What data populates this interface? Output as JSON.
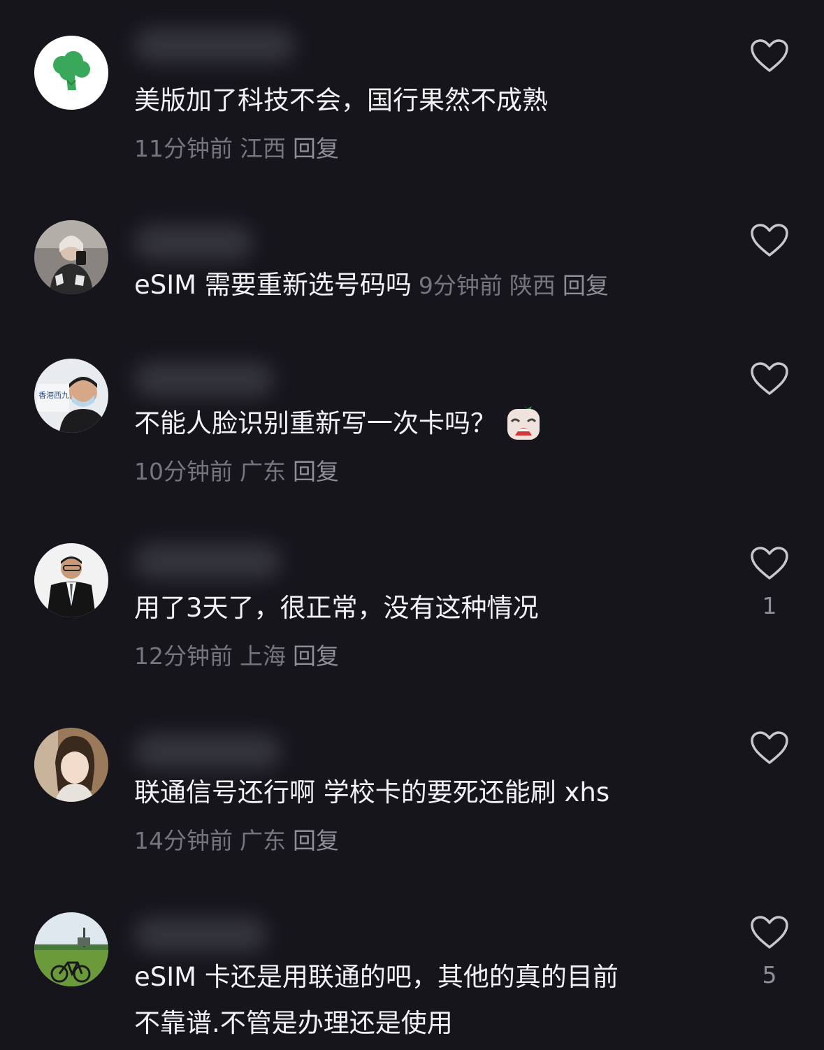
{
  "comments": [
    {
      "text": "美版加了科技不会，国行果然不成熟",
      "time": "11分钟前",
      "location": "江西",
      "reply_label": "回复",
      "like_count": "",
      "avatar_icon": "broccoli-avatar"
    },
    {
      "text": "eSIM 需要重新选号码吗",
      "time": "9分钟前",
      "location": "陕西",
      "reply_label": "回复",
      "like_count": "",
      "avatar_icon": "mirror-selfie-avatar"
    },
    {
      "text": "不能人脸识别重新写一次卡吗？",
      "time": "10分钟前",
      "location": "广东",
      "reply_label": "回复",
      "like_count": "",
      "avatar_icon": "masked-man-avatar",
      "emoji": "crying-face-emoji"
    },
    {
      "text": "用了3天了，很正常，没有这种情况",
      "time": "12分钟前",
      "location": "上海",
      "reply_label": "回复",
      "like_count": "1",
      "avatar_icon": "suit-man-avatar"
    },
    {
      "text": "联通信号还行啊 学校卡的要死还能刷 xhs",
      "time": "14分钟前",
      "location": "广东",
      "reply_label": "回复",
      "like_count": "",
      "avatar_icon": "girl-avatar"
    },
    {
      "text_line1": "eSIM 卡还是用联通的吧，其他的真的目前",
      "text_line2": "不靠谱.不管是办理还是使用",
      "like_count": "5",
      "avatar_icon": "bicycle-field-avatar"
    }
  ],
  "colors": {
    "background": "#16151c",
    "text": "#f2f2f4",
    "meta": "#75757e",
    "icon": "#c8c8cc"
  }
}
